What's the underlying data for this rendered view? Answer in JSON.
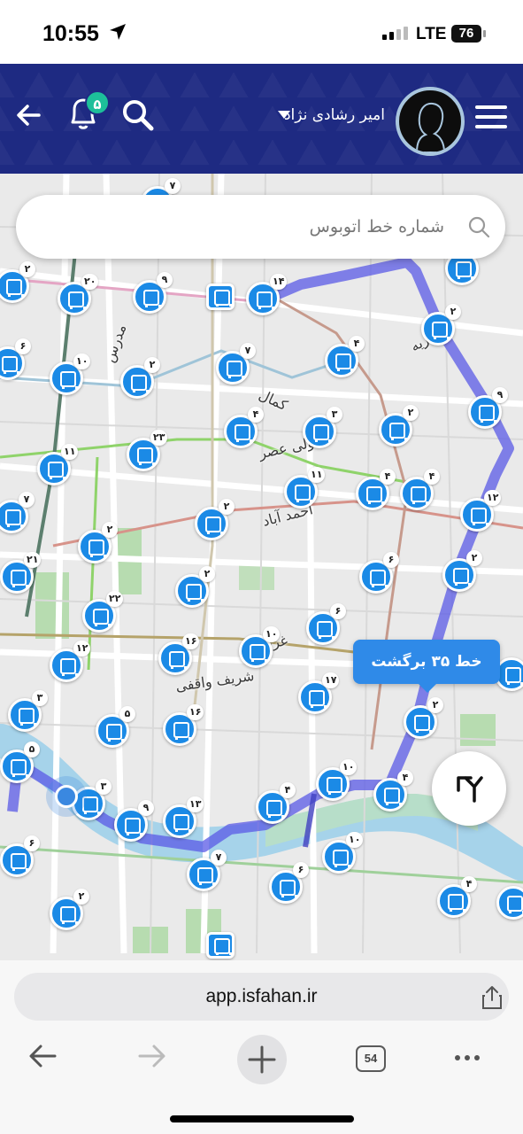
{
  "status_bar": {
    "time": "10:55",
    "network": "LTE",
    "battery": "76"
  },
  "header": {
    "user_name": "امیر رشادی نژاد",
    "notifications_count": "۵"
  },
  "search": {
    "placeholder": "شماره خط اتوبوس"
  },
  "route_tooltip": {
    "label": "خط ۳۵ برگشت"
  },
  "map_labels": [
    "مدرس",
    "کمال",
    "ولی عصر",
    "احمد آباد",
    "شریف واقفی",
    "غربی",
    "عبدریه"
  ],
  "stop_counts": [
    "۷",
    "۲",
    "۲۰",
    "۹",
    "۱۴",
    "۲",
    "۶",
    "۱۰",
    "۲",
    "۷",
    "۴",
    "۹",
    "۳",
    "۲",
    "۴",
    "۲۳",
    "۱۱",
    "۱۱",
    "۴",
    "۴",
    "۷",
    "۲",
    "۱۲",
    "۲",
    "۲۱",
    "۶",
    "۲",
    "۲",
    "۲۲",
    "۶",
    "۱۶",
    "۱۰",
    "۱۲",
    "۱۷",
    "۲",
    "۳",
    "۵",
    "۱۶",
    "۵",
    "۱۰",
    "۳",
    "۹",
    "۱۳",
    "۴",
    "۴",
    "۷",
    "۱۰",
    "۶",
    "۶",
    "۴",
    "۲"
  ],
  "browser": {
    "url": "app.isfahan.ir",
    "tabs_count": "54"
  },
  "colors": {
    "header": "#1e2a82",
    "stop": "#1b8ae6",
    "route": "#6b6be8",
    "tooltip": "#2f8ae8",
    "badge": "#1dbf9a"
  }
}
